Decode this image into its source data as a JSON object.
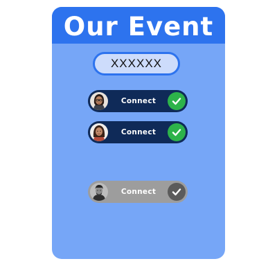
{
  "event": {
    "title": "Our Event",
    "code_value": "XXXXXX"
  },
  "connections": [
    {
      "label": "Connect",
      "status": "connected",
      "avatar": "woman-with-glasses-avatar"
    },
    {
      "label": "Connect",
      "status": "connected",
      "avatar": "woman-avatar"
    },
    {
      "label": "Connect",
      "status": "disabled",
      "avatar": "man-avatar"
    }
  ],
  "colors": {
    "header": "#2d73ee",
    "card": "#76a6f7",
    "pill_active": "#0f2a58",
    "pill_inactive": "#9d9d9d",
    "check_active": "#2db34a",
    "check_inactive": "#5b5b5b"
  }
}
